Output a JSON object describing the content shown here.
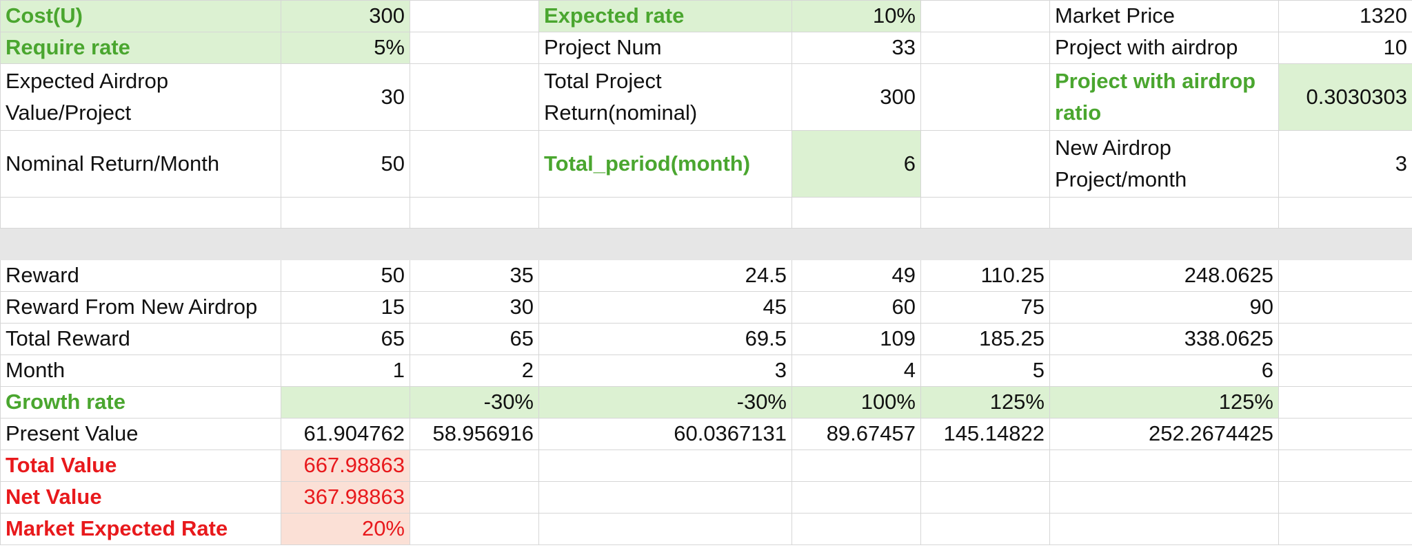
{
  "params": {
    "cost_label": "Cost(U)",
    "cost_value": "300",
    "require_rate_label": "Require rate",
    "require_rate_value": "5%",
    "expected_airdrop_label": "Expected Airdrop Value/Project",
    "expected_airdrop_value": "30",
    "nominal_return_label": "Nominal Return/Month",
    "nominal_return_value": "50",
    "expected_rate_label": "Expected rate",
    "expected_rate_value": "10%",
    "project_num_label": "Project Num",
    "project_num_value": "33",
    "total_project_return_label": "Total Project Return(nominal)",
    "total_project_return_value": "300",
    "total_period_label": "Total_period(month)",
    "total_period_value": "6",
    "market_price_label": "Market Price",
    "market_price_value": "1320",
    "project_airdrop_label": "Project with airdrop",
    "project_airdrop_value": "10",
    "airdrop_ratio_label": "Project with airdrop ratio",
    "airdrop_ratio_value": "0.3030303",
    "new_airdrop_label": "New Airdrop Project/month",
    "new_airdrop_value": "3"
  },
  "table": {
    "reward": {
      "label": "Reward",
      "values": [
        "50",
        "35",
        "24.5",
        "49",
        "110.25",
        "248.0625"
      ]
    },
    "reward_new": {
      "label": "Reward From New Airdrop",
      "values": [
        "15",
        "30",
        "45",
        "60",
        "75",
        "90"
      ]
    },
    "total_reward": {
      "label": "Total Reward",
      "values": [
        "65",
        "65",
        "69.5",
        "109",
        "185.25",
        "338.0625"
      ]
    },
    "month": {
      "label": "Month",
      "values": [
        "1",
        "2",
        "3",
        "4",
        "5",
        "6"
      ]
    },
    "growth": {
      "label": "Growth rate",
      "values": [
        "",
        "-30%",
        "-30%",
        "100%",
        "125%",
        "125%"
      ]
    },
    "present_value": {
      "label": "Present Value",
      "values": [
        "61.904762",
        "58.956916",
        "60.0367131",
        "89.67457",
        "145.14822",
        "252.2674425"
      ]
    }
  },
  "summary": {
    "total_value_label": "Total Value",
    "total_value": "667.98863",
    "net_value_label": "Net Value",
    "net_value": "367.98863",
    "market_rate_label": "Market Expected Rate",
    "market_rate": "20%"
  },
  "colors": {
    "green_text": "#4aa62f",
    "green_fill": "#dcf1d2",
    "red_text": "#e8191c",
    "red_fill": "#fbe0d6",
    "gridline": "#d6d6d6"
  }
}
